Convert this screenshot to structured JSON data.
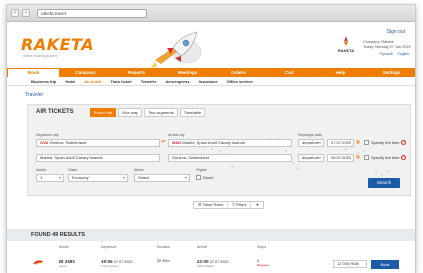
{
  "browser": {
    "back": "‹",
    "forward": "›",
    "url": "raketa.travel"
  },
  "header": {
    "logo": "RAKETA",
    "logo_tagline": "online booking system",
    "sign_in": "Sign out",
    "brand_small": "RAKETA",
    "company_line1": "Company: Raketa",
    "company_line2": "Today: Monday 27 Jan 2020",
    "lang_ru": "Русский",
    "lang_en": "English"
  },
  "main_menu": [
    "Book",
    "Company",
    "Reports",
    "Meetings",
    "Orders",
    "Cart",
    "Help",
    "Settings"
  ],
  "sub_menu": [
    "Business trip",
    "Hotel",
    "Air ticket",
    "Train ticket",
    "Transfer",
    "Aeroexpress",
    "Insurance",
    "Office service"
  ],
  "traveler_link": "Traveler",
  "search": {
    "title": "AIR TICKETS",
    "trip_types": [
      "Round trip",
      "One way",
      "Two segments",
      "Timetable"
    ],
    "departure_label": "Departure city",
    "arrival_label": "Arrival city",
    "date_label": "Departure date",
    "from_code": "GVA",
    "from_value": "Geneva, Switzerland",
    "to_code": "MAD",
    "to_value": "Madrid, Spain Adolf Canary Islands",
    "return_from": "Madrid, Spain Adolf Canary Islands",
    "return_to": "Geneva, Switzerland",
    "date1_mode": "departure",
    "date1": "07.07.2020",
    "date2_mode": "departure",
    "date2": "08.07.2020",
    "time_label": "Specify the time",
    "adults_label": "Adults",
    "adults_value": "1",
    "class_label": "Class",
    "class_value": "Economy",
    "airline_label": "Airline",
    "airline_value": "Select",
    "flights_label": "Flights",
    "direct_label": "Direct",
    "search_button": "Search"
  },
  "tools": {
    "ticket_rules": "Ticket Rules",
    "filters": "Filters"
  },
  "results": {
    "title": "FOUND 49 RESULTS",
    "headers": [
      "Airline",
      "Departure",
      "Duration",
      "Arrival",
      "Stops"
    ],
    "row": {
      "flight_number": "IB 3483",
      "airline_name": "Iberia",
      "dep_time": "19:55",
      "dep_date": "07.07.2020",
      "dep_place": "GVA Geneva",
      "duration": "2h 30m",
      "arr_time": "22:00",
      "arr_date": "07.07.2020",
      "arr_place": "MAD Madrid",
      "stops": "0",
      "baggage": "Baggage",
      "price": "12 000 RUB",
      "book": "Book"
    }
  },
  "colors": {
    "brand_orange": "#ef7d00",
    "brand_blue": "#1d5aa8",
    "code_red": "#d42b2b"
  }
}
